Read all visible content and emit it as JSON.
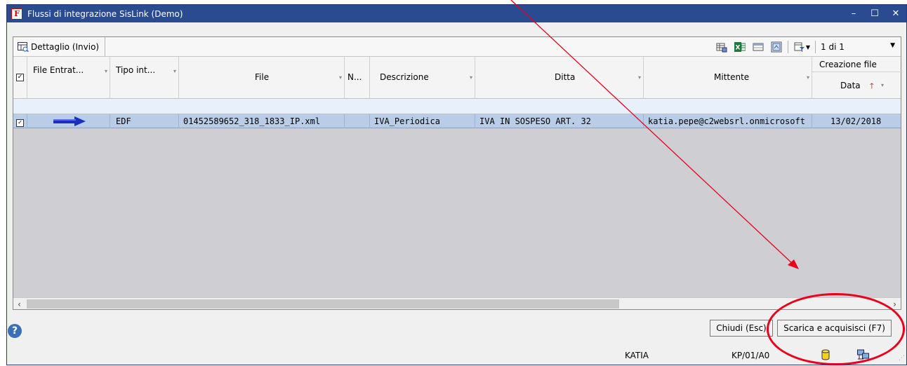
{
  "window": {
    "title": "Flussi di integrazione SisLink  (Demo)",
    "app_icon_letter": "F",
    "controls": {
      "minimize": "–",
      "maximize": "☐",
      "close": "✕"
    }
  },
  "toolbar": {
    "view_label": "Dettaglio (Invio)",
    "page_counter": "1 di 1"
  },
  "columns": {
    "entrata": "File Entrat...",
    "tipo": "Tipo int...",
    "file": "File",
    "n": "N...",
    "descrizione": "Descrizione",
    "ditta": "Ditta",
    "mittente": "Mittente",
    "creazione_group": "Creazione file",
    "data": "Data"
  },
  "rows": [
    {
      "checked": "✓",
      "tipo": "EDF",
      "file": "01452589652_318_1833_IP.xml",
      "descrizione": "IVA_Periodica",
      "ditta": "IVA IN SOSPESO ART. 32",
      "mittente": "katia.pepe@c2websrl.onmicrosoft",
      "data": "13/02/2018"
    }
  ],
  "buttons": {
    "close": "Chiudi (Esc)",
    "download": "Scarica e acquisisci (F7)"
  },
  "status": {
    "user": "KATIA",
    "code": "KP/01/A0"
  },
  "colors": {
    "titlebar": "#2a4b8f",
    "selected_row": "#b9cde8",
    "annotation": "#e8001c"
  }
}
